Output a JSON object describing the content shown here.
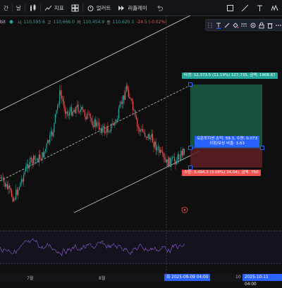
{
  "toolbar": {
    "interval_label": "간",
    "period_label": "날",
    "indicators_label": "지표",
    "alert_label": "얼러트",
    "replay_label": "리플레이"
  },
  "legend": {
    "symbol_fragment": "bit",
    "open_label": "시",
    "open_value": "110,595.6",
    "high_label": "고",
    "high_value": "110,666.0",
    "low_label": "저",
    "low_value": "110,454.9",
    "close_label": "종",
    "close_value": "110,620.1",
    "change": "-24.5 (-0.02%)"
  },
  "drawing_tools": [
    "drag-handle-icon",
    "text-tool-icon",
    "brush-icon",
    "fill-icon",
    "line-style-icon",
    "settings-icon",
    "lock-icon",
    "delete-icon",
    "more-icon"
  ],
  "position_tool": {
    "target_label": "타겟: 12,373.5 (11.19%) 127,735, 금액: 1908.67",
    "center_label_1": "오픈포지션 손익: 59.3, 수량: 0.073",
    "center_label_2": "위험/보상 비율: 3.63",
    "stop_label": "스탑: 3,494.3 (3.08%) 34,04), 금액: 750",
    "colors": {
      "profit": "#1a5e45",
      "loss": "#5e1f24",
      "line": "#2962ff"
    }
  },
  "x_axis": {
    "labels": [
      "7월",
      "8월"
    ],
    "crosshair_badge_1": "화 2025-09-09  04:00",
    "crosshair_badge_2": "10",
    "crosshair_badge_3": "2025-10-11  04:00"
  },
  "colors": {
    "up": "#26a69a",
    "down": "#ef5350",
    "rsi": "#7e57c2",
    "background": "#0f0f10"
  }
}
